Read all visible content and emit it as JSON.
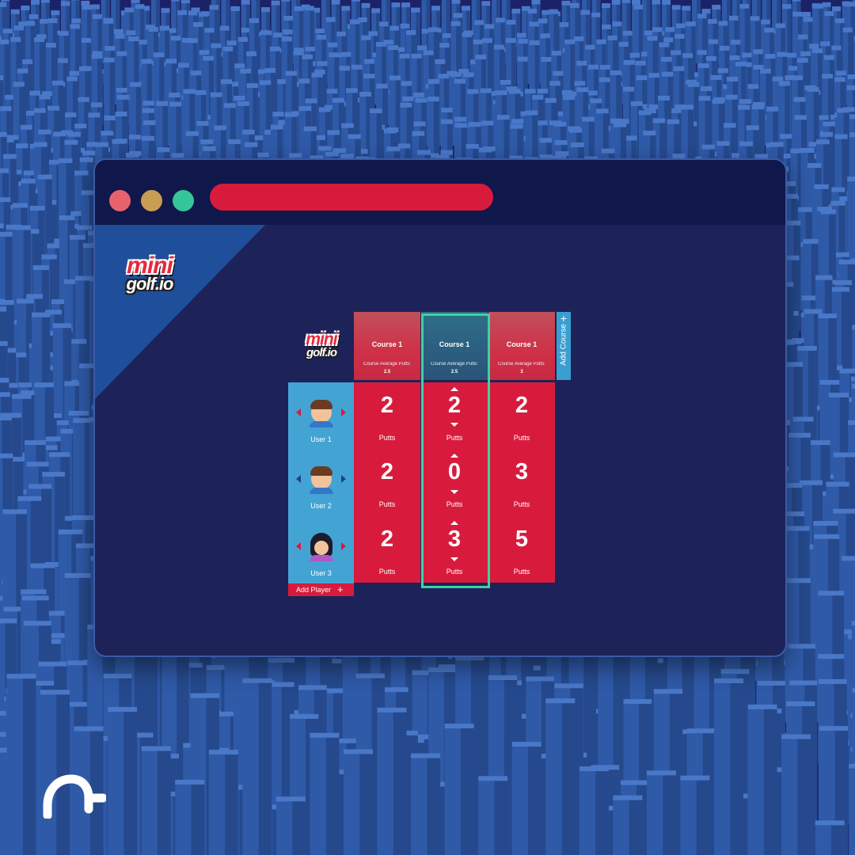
{
  "window": {
    "controls": [
      "close-dot",
      "minimize-dot",
      "maximize-dot"
    ],
    "address_bar_color": "#d81b3c"
  },
  "brand": {
    "logo_line1": "mini",
    "logo_line2": "golf.io",
    "corner_logo": "brand-a-icon"
  },
  "courses": [
    {
      "title": "Course 1",
      "avg_label": "Course Average Putts:",
      "avg_value": "2.5",
      "selected": false
    },
    {
      "title": "Course 1",
      "avg_label": "Course Average Putts:",
      "avg_value": "2.5",
      "selected": true
    },
    {
      "title": "Course 1",
      "avg_label": "Course Average Putts:",
      "avg_value": "3",
      "selected": false
    }
  ],
  "add_course": {
    "label": "Add Course",
    "icon": "plus-icon"
  },
  "players": [
    {
      "name": "User 1",
      "avatar": "boy-avatar"
    },
    {
      "name": "User 2",
      "avatar": "boy-avatar"
    },
    {
      "name": "User 3",
      "avatar": "girl-avatar"
    }
  ],
  "add_player": {
    "label": "Add Player",
    "icon": "plus-icon"
  },
  "scores": {
    "unit": "Putts",
    "columns": [
      [
        "2",
        "2",
        "2"
      ],
      [
        "2",
        "0",
        "3"
      ],
      [
        "2",
        "3",
        "5"
      ]
    ]
  },
  "colors": {
    "accent_red": "#d81b3c",
    "player_blue": "#43a4d4",
    "selection_green": "#3ed1a4",
    "window_bg": "#1d2358",
    "page_bg": "#1c2268"
  }
}
